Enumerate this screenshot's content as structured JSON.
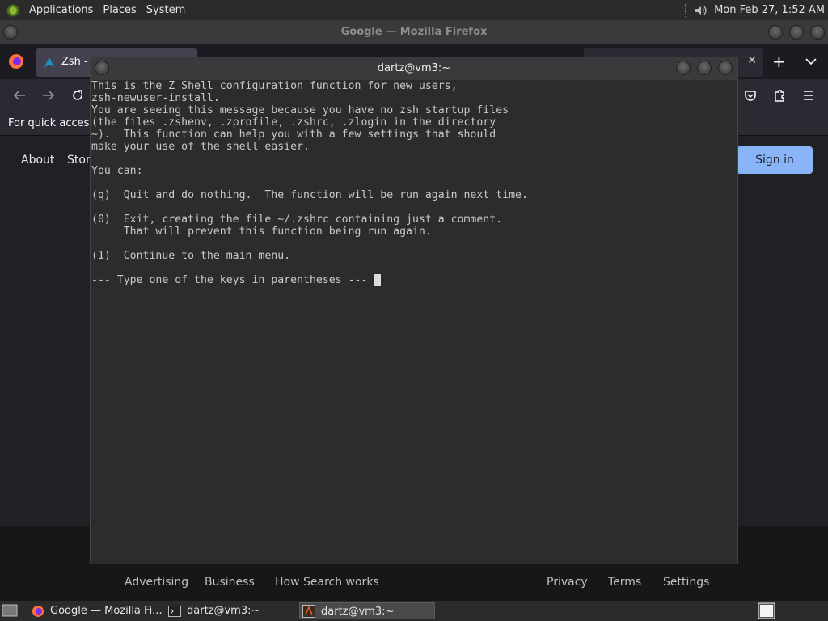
{
  "top_panel": {
    "menus": [
      "Applications",
      "Places",
      "System"
    ],
    "clock": "Mon Feb 27,  1:52 AM"
  },
  "firefox": {
    "title": "Google — Mozilla Firefox",
    "tab_label": "Zsh -",
    "bookmarks_text": "For quick access,",
    "google": {
      "top_links": [
        "About",
        "Store"
      ],
      "signin": "Sign in",
      "footer_left": [
        "Advertising",
        "Business",
        "How Search works"
      ],
      "footer_right": [
        "Privacy",
        "Terms",
        "Settings"
      ]
    }
  },
  "terminal": {
    "title": "dartz@vm3:~",
    "lines": [
      "This is the Z Shell configuration function for new users,",
      "zsh-newuser-install.",
      "You are seeing this message because you have no zsh startup files",
      "(the files .zshenv, .zprofile, .zshrc, .zlogin in the directory",
      "~).  This function can help you with a few settings that should",
      "make your use of the shell easier.",
      "",
      "You can:",
      "",
      "(q)  Quit and do nothing.  The function will be run again next time.",
      "",
      "(0)  Exit, creating the file ~/.zshrc containing just a comment.",
      "     That will prevent this function being run again.",
      "",
      "(1)  Continue to the main menu.",
      "",
      "--- Type one of the keys in parentheses --- "
    ]
  },
  "taskbar": {
    "items": [
      "Google — Mozilla Fi...",
      "dartz@vm3:~",
      "dartz@vm3:~"
    ]
  }
}
